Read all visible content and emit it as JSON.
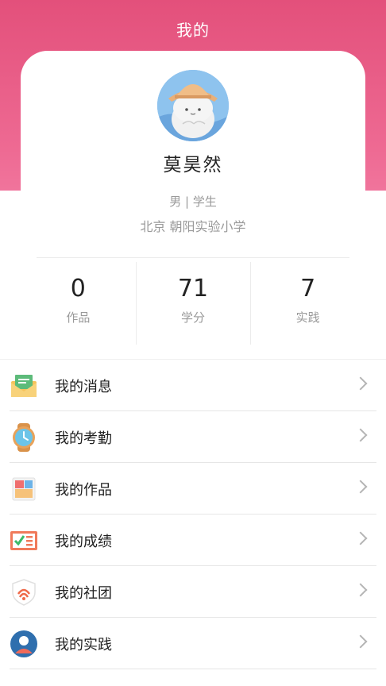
{
  "header": {
    "title": "我的"
  },
  "profile": {
    "name": "莫昊然",
    "meta": "男 | 学生",
    "school": "北京 朝阳实验小学"
  },
  "stats": [
    {
      "value": "0",
      "label": "作品"
    },
    {
      "value": "71",
      "label": "学分"
    },
    {
      "value": "7",
      "label": "实践"
    }
  ],
  "menu": [
    {
      "label": "我的消息",
      "icon": "envelope-icon"
    },
    {
      "label": "我的考勤",
      "icon": "watch-icon"
    },
    {
      "label": "我的作品",
      "icon": "artwork-icon"
    },
    {
      "label": "我的成绩",
      "icon": "report-card-icon"
    },
    {
      "label": "我的社团",
      "icon": "shield-badge-icon"
    },
    {
      "label": "我的实践",
      "icon": "user-circle-icon"
    }
  ],
  "colors": {
    "accent": "#e3507b"
  }
}
